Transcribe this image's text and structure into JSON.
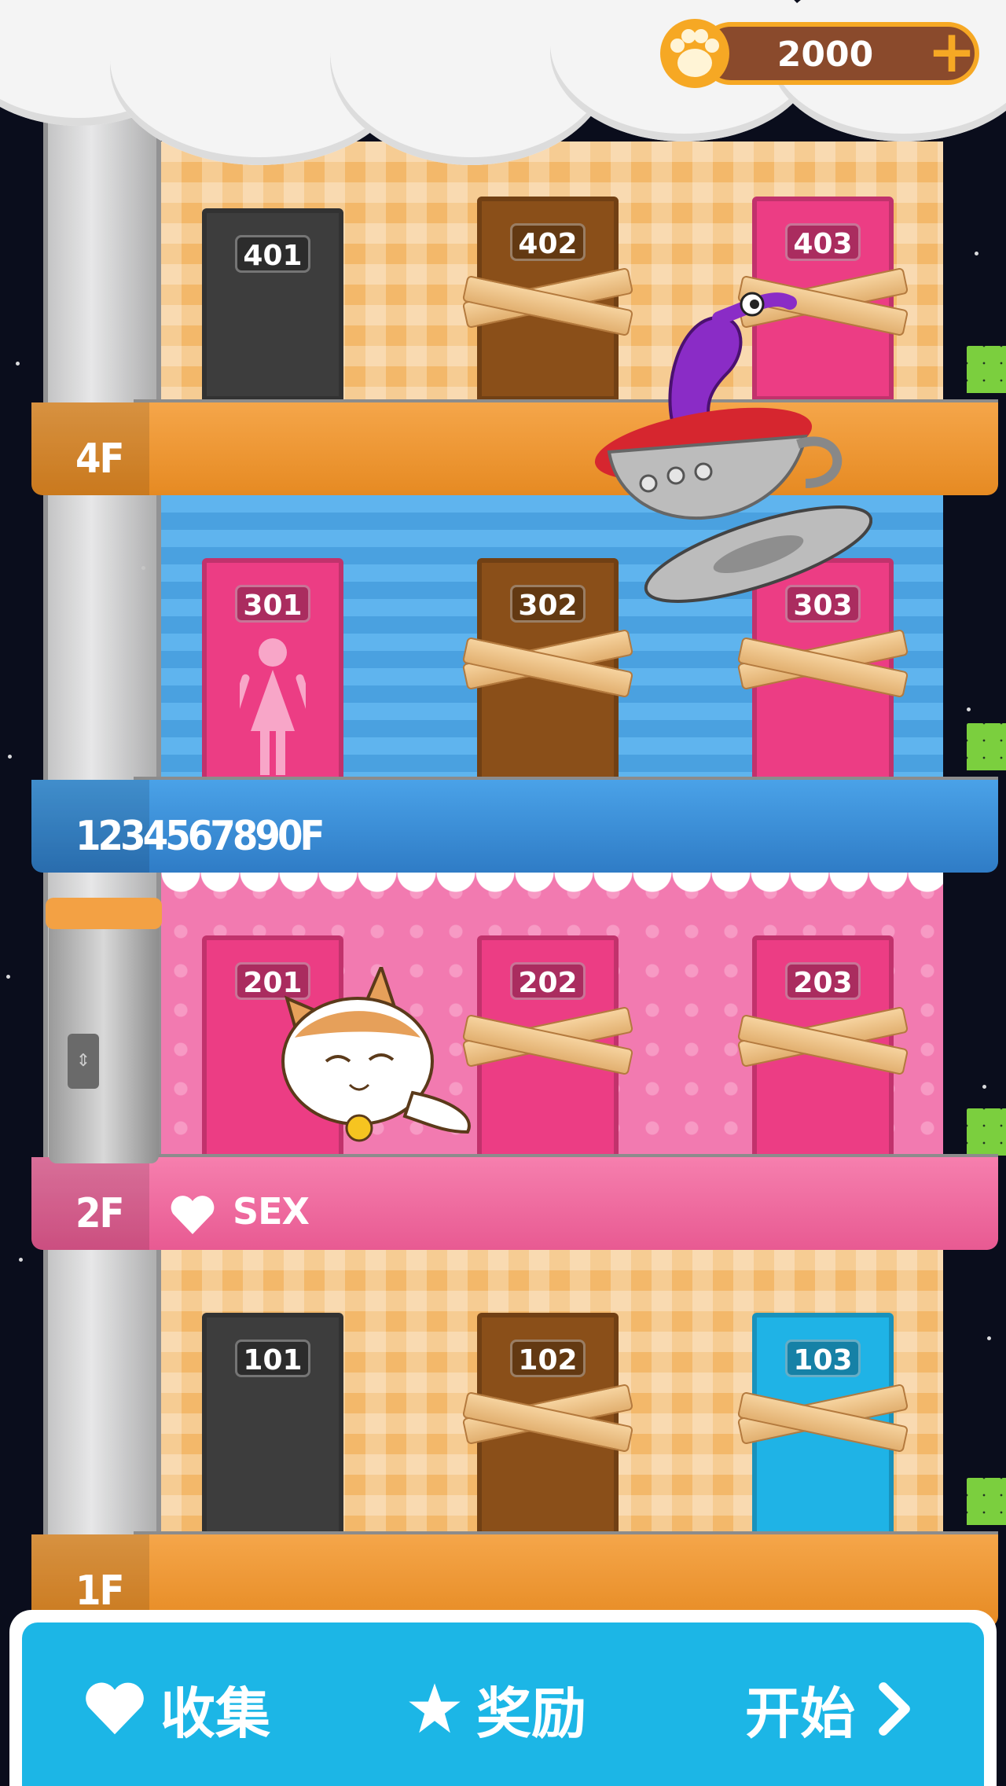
{
  "currency": {
    "amount": "2000",
    "icon": "paw-icon",
    "add_icon": "plus-icon"
  },
  "floors": [
    {
      "label": "4F",
      "doors": [
        "401",
        "402",
        "403"
      ]
    },
    {
      "label": "1234567890F",
      "doors": [
        "301",
        "302",
        "303"
      ]
    },
    {
      "label": "2F",
      "tag": "SEX",
      "doors": [
        "201",
        "202",
        "203"
      ]
    },
    {
      "label": "1F",
      "doors": [
        "101",
        "102",
        "103"
      ]
    }
  ],
  "bottom_nav": {
    "collect": "收集",
    "rewards": "奖励",
    "start": "开始"
  },
  "colors": {
    "bar_orange": "#e68a22",
    "bar_blue": "#2f7cc6",
    "bar_pink": "#e85a92",
    "nav_bg": "#1cb6e6",
    "coin_border": "#f6a824"
  }
}
